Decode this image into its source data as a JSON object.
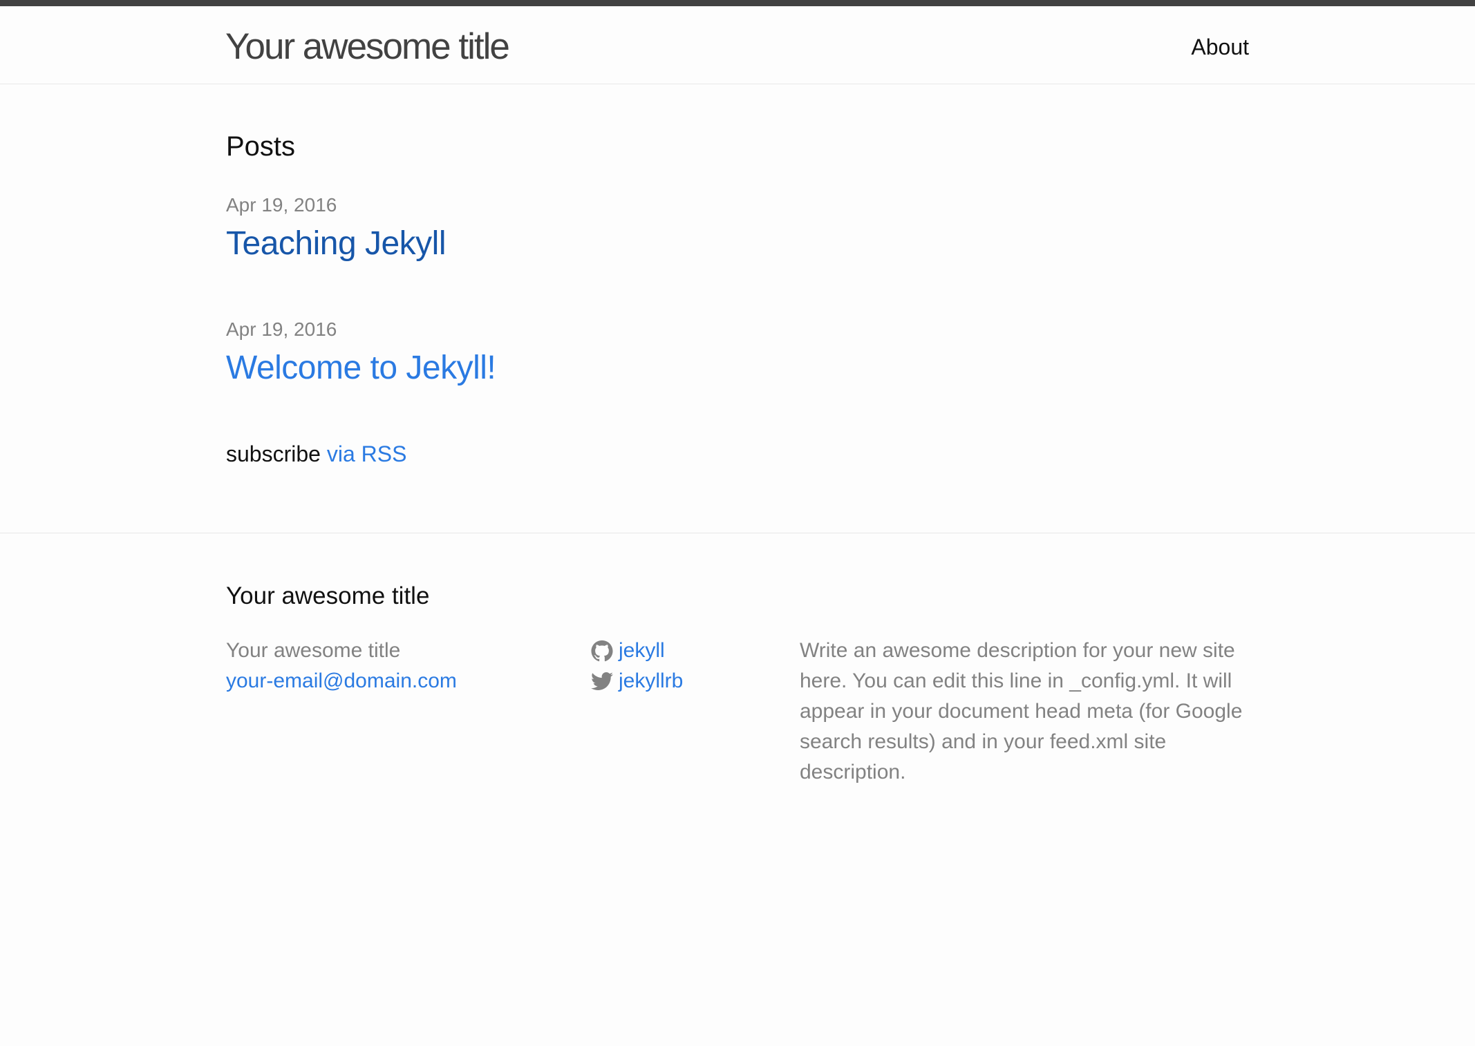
{
  "header": {
    "site_title": "Your awesome title",
    "nav": [
      {
        "label": "About"
      }
    ]
  },
  "main": {
    "heading": "Posts",
    "posts": [
      {
        "date": "Apr 19, 2016",
        "title": "Teaching Jekyll",
        "visited": true
      },
      {
        "date": "Apr 19, 2016",
        "title": "Welcome to Jekyll!",
        "visited": false
      }
    ],
    "rss": {
      "prefix": "subscribe",
      "link_label": "via RSS"
    }
  },
  "footer": {
    "heading": "Your awesome title",
    "site_name": "Your awesome title",
    "email": "your-email@domain.com",
    "social": [
      {
        "icon": "github-icon",
        "label": "jekyll"
      },
      {
        "icon": "twitter-icon",
        "label": "jekyllrb"
      }
    ],
    "description": "Write an awesome description for your new site here. You can edit this line in _config.yml. It will appear in your document head meta (for Google search results) and in your feed.xml site description."
  },
  "colors": {
    "link": "#2a7ae2",
    "link_visited": "#1756a9",
    "muted_text": "#828282",
    "top_bar": "#424242"
  }
}
